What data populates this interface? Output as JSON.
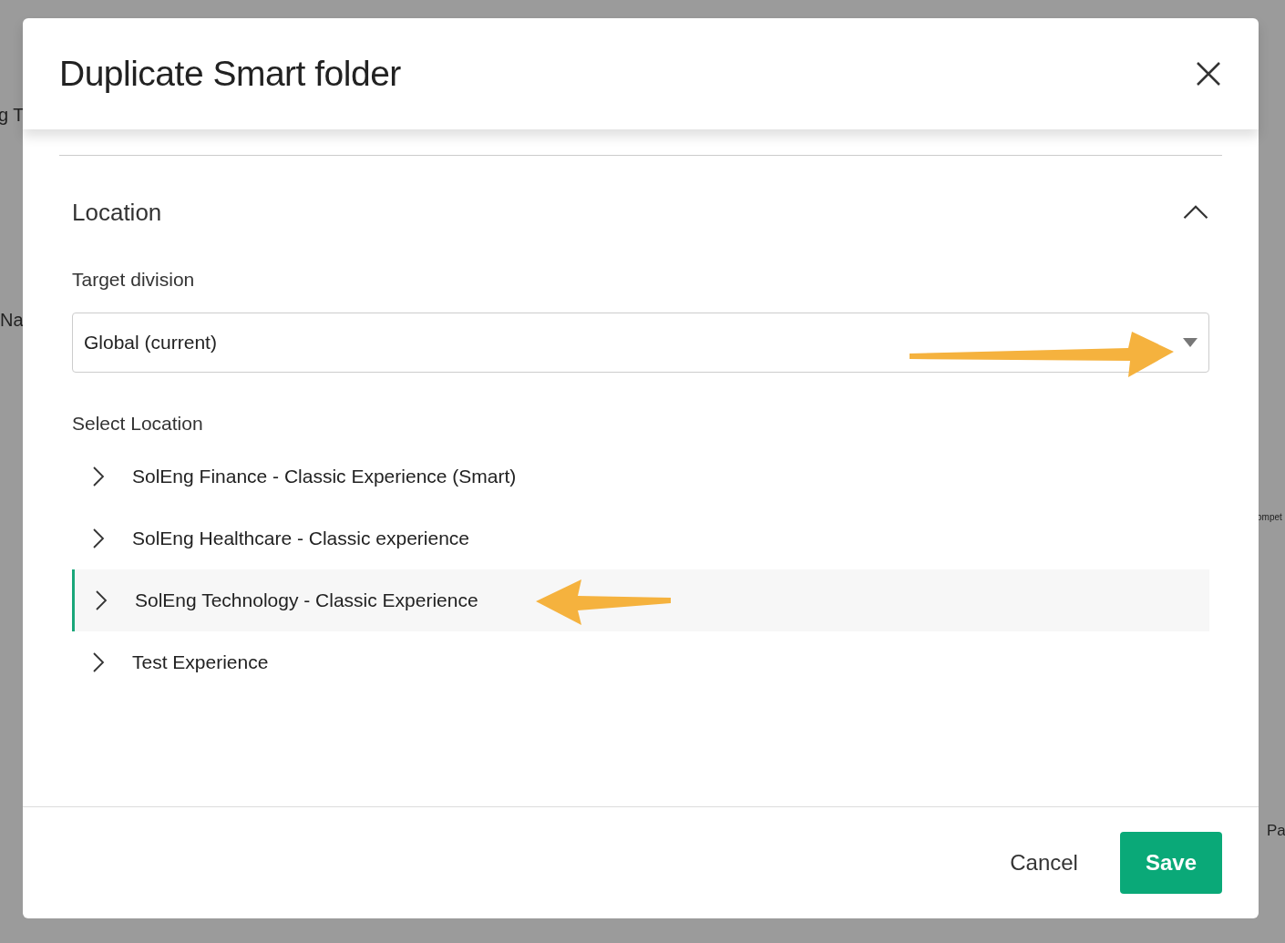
{
  "background": {
    "fragments": [
      {
        "text": "g T"
      },
      {
        "text": "Na"
      },
      {
        "text": "ompet"
      },
      {
        "text": "Pa"
      }
    ]
  },
  "dialog": {
    "title": "Duplicate Smart folder",
    "section": {
      "title": "Location",
      "expanded": true,
      "target_division": {
        "label": "Target division",
        "value": "Global (current)"
      },
      "select_location": {
        "label": "Select Location",
        "items": [
          {
            "label": "SolEng Finance - Classic Experience (Smart)",
            "selected": false,
            "expanded": false
          },
          {
            "label": "SolEng Healthcare - Classic experience",
            "selected": false,
            "expanded": false
          },
          {
            "label": "SolEng Technology - Classic Experience",
            "selected": true,
            "expanded": false
          },
          {
            "label": "Test Experience",
            "selected": false,
            "expanded": false
          }
        ]
      }
    },
    "buttons": [
      {
        "label": "Cancel",
        "kind": "secondary"
      },
      {
        "label": "Save",
        "kind": "primary"
      }
    ]
  },
  "annotations": [
    {
      "kind": "arrow-right"
    },
    {
      "kind": "arrow-left"
    }
  ]
}
